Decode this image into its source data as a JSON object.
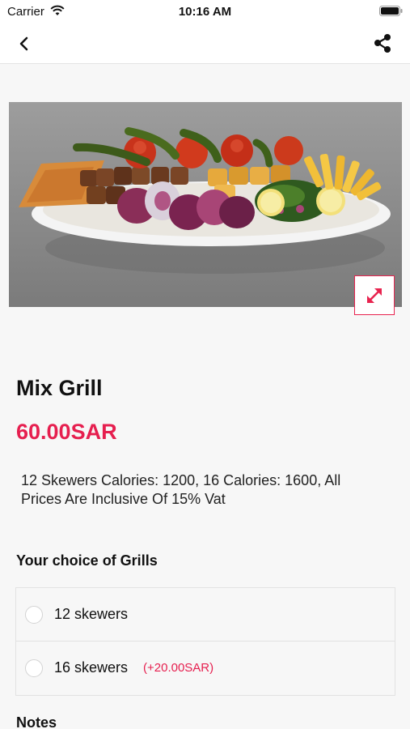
{
  "status_bar": {
    "carrier": "Carrier",
    "time": "10:16 AM"
  },
  "product": {
    "name": "Mix Grill",
    "price": "60.00SAR",
    "description": "12 Skewers Calories: 1200, 16 Calories: 1600, All Prices Are Inclusive Of 15% Vat"
  },
  "choice_section": {
    "title": "Your choice of Grills",
    "options": [
      {
        "label": "12 skewers",
        "extra": ""
      },
      {
        "label": "16 skewers",
        "extra": "(+20.00SAR)"
      }
    ]
  },
  "notes": {
    "title": "Notes"
  },
  "colors": {
    "accent": "#e61f4f",
    "background": "#f7f7f7"
  },
  "icons": [
    "wifi-icon",
    "battery-icon",
    "back-chevron-icon",
    "share-icon",
    "expand-icon"
  ]
}
